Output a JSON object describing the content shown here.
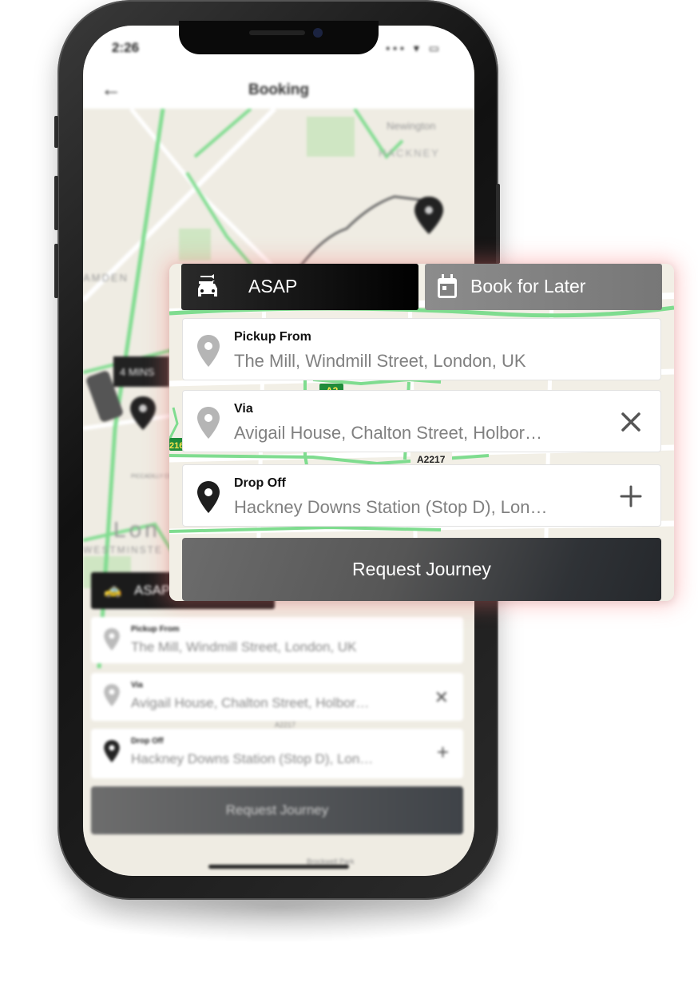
{
  "phone": {
    "status_time": "2:26",
    "status_icons": "••• ▾ ▭",
    "header_title": "Booking",
    "back_icon": "arrow-left-icon",
    "map_labels": {
      "camden": "AMDEN",
      "hackney": "HACKNEY",
      "newington": "Newington",
      "london": "Lon",
      "westminster": "WESTMINSTE",
      "eta": "4 MINS",
      "piccadilly": "PICCADILLY CIRCUS",
      "brockwell": "Brockwell Park"
    },
    "mini_booking": {
      "asap_label": "ASAP",
      "pickup_label": "Pickup From",
      "pickup_value": "The Mill, Windmill Street, London, UK",
      "via_label": "Via",
      "via_value": "Avigail House, Chalton Street, Holbor…",
      "dropoff_label": "Drop Off",
      "dropoff_value": "Hackney Downs Station (Stop D), Lon…",
      "road_label": "A2217",
      "request_label": "Request Journey"
    }
  },
  "booking": {
    "tabs": [
      {
        "label": "ASAP",
        "icon": "car-icon",
        "active": true
      },
      {
        "label": "Book for Later",
        "icon": "calendar-icon",
        "active": false
      }
    ],
    "pickup": {
      "label": "Pickup From",
      "value": "The Mill, Windmill Street, London, UK",
      "icon": "location-pin-icon"
    },
    "via": {
      "label": "Via",
      "value": "Avigail House, Chalton Street, Holbor…",
      "icon": "location-pin-icon",
      "action_icon": "close-icon"
    },
    "dropoff": {
      "label": "Drop Off",
      "value": "Hackney Downs Station (Stop D), Lon…",
      "icon": "location-pin-icon",
      "action_icon": "plus-icon"
    },
    "request_label": "Request Journey",
    "map_labels": {
      "road_a2": "A2",
      "road_a2217": "A2217",
      "road_216": "216"
    }
  },
  "colors": {
    "active_tab": "#111111",
    "inactive_tab": "#808080",
    "map_road_green": "#7fdc8f",
    "map_background": "#f2efe6",
    "panel_glow": "#ff7878"
  }
}
